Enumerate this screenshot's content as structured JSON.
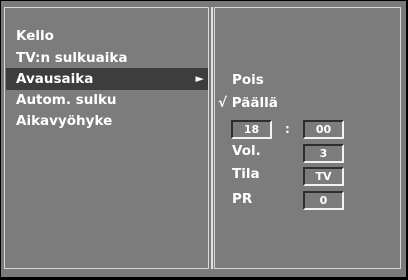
{
  "menu": {
    "items": [
      {
        "label": "Kello"
      },
      {
        "label": "TV:n sulkuaika"
      },
      {
        "label": "Avausaika",
        "arrow": "►"
      },
      {
        "label": "Autom. sulku"
      },
      {
        "label": "Aikavyöhyke"
      }
    ],
    "selected_index": 2
  },
  "submenu": {
    "option_off": "Pois",
    "option_on_check": "√",
    "option_on": "Päällä",
    "time": {
      "hour": "18",
      "separator": ":",
      "minute": "00"
    },
    "vol": {
      "label": "Vol.",
      "value": "3"
    },
    "mode": {
      "label": "Tila",
      "value": "TV"
    },
    "pr": {
      "label": "PR",
      "value": "0"
    }
  },
  "colors": {
    "panel": "#7c7c7c",
    "selected": "#3d3d3d",
    "background": "#000000"
  }
}
